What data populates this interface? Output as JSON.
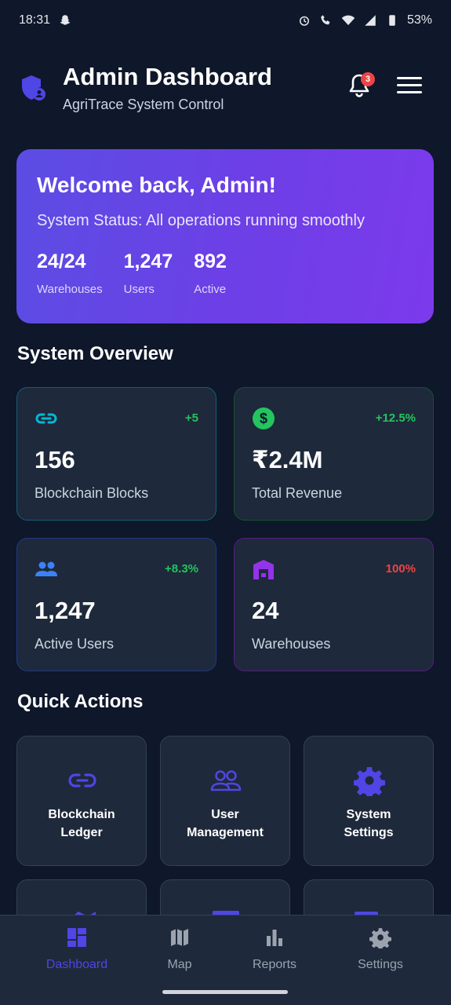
{
  "status_bar": {
    "time": "18:31",
    "battery": "53%"
  },
  "header": {
    "title": "Admin Dashboard",
    "subtitle": "AgriTrace System Control",
    "notification_count": "3"
  },
  "welcome": {
    "title": "Welcome back, Admin!",
    "status": "System Status: All operations running smoothly",
    "stats": [
      {
        "value": "24/24",
        "label": "Warehouses"
      },
      {
        "value": "1,247",
        "label": "Users"
      },
      {
        "value": "892",
        "label": "Active"
      }
    ]
  },
  "overview": {
    "title": "System Overview",
    "cards": [
      {
        "icon": "link-icon",
        "change": "+5",
        "value": "156",
        "label": "Blockchain Blocks",
        "accent": "#06b6d4",
        "change_color": "#22c55e"
      },
      {
        "icon": "dollar-icon",
        "change": "+12.5%",
        "value": "₹2.4M",
        "label": "Total Revenue",
        "accent": "#22c55e",
        "change_color": "#22c55e"
      },
      {
        "icon": "users-icon",
        "change": "+8.3%",
        "value": "1,247",
        "label": "Active Users",
        "accent": "#3b82f6",
        "change_color": "#22c55e"
      },
      {
        "icon": "warehouse-icon",
        "change": "100%",
        "value": "24",
        "label": "Warehouses",
        "accent": "#9333ea",
        "change_color": "#ef4444"
      }
    ]
  },
  "quick_actions": {
    "title": "Quick Actions",
    "items": [
      {
        "icon": "link-icon",
        "label": "Blockchain\nLedger"
      },
      {
        "icon": "user-group-icon",
        "label": "User\nManagement"
      },
      {
        "icon": "gear-icon",
        "label": "System\nSettings"
      }
    ]
  },
  "bottom_nav": [
    {
      "icon": "dashboard-icon",
      "label": "Dashboard",
      "active": true
    },
    {
      "icon": "map-icon",
      "label": "Map",
      "active": false
    },
    {
      "icon": "bar-chart-icon",
      "label": "Reports",
      "active": false
    },
    {
      "icon": "gear-icon",
      "label": "Settings",
      "active": false
    }
  ],
  "colors": {
    "background": "#0f172a",
    "card": "#1e293b",
    "accent": "#4f46e5",
    "gradient_start": "#5b4de3",
    "gradient_end": "#7c3aed"
  }
}
